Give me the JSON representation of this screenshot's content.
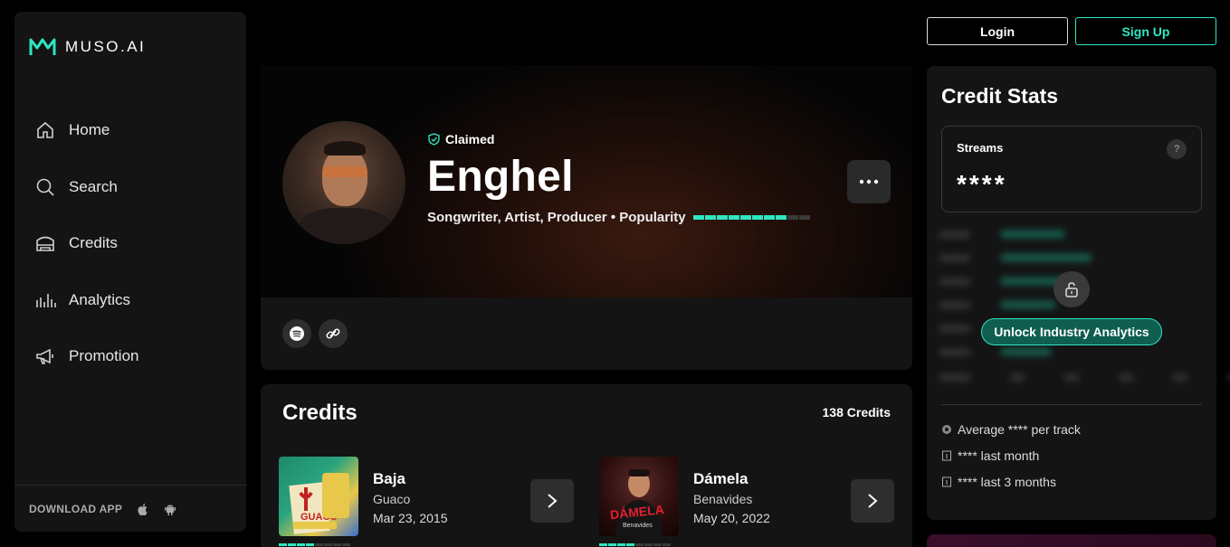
{
  "brand": {
    "name": "MUSO.AI",
    "accent": "#2ee6c2"
  },
  "sidebar": {
    "items": [
      {
        "label": "Home",
        "icon": "home-icon"
      },
      {
        "label": "Search",
        "icon": "search-icon"
      },
      {
        "label": "Credits",
        "icon": "credits-icon"
      },
      {
        "label": "Analytics",
        "icon": "analytics-icon"
      },
      {
        "label": "Promotion",
        "icon": "megaphone-icon"
      }
    ],
    "download_label": "DOWNLOAD APP"
  },
  "auth": {
    "login_label": "Login",
    "signup_label": "Sign Up"
  },
  "profile": {
    "claimed_label": "Claimed",
    "name": "Enghel",
    "roles": "Songwriter, Artist, Producer • Popularity",
    "popularity": 0.75
  },
  "credits": {
    "title": "Credits",
    "count": "138 Credits",
    "items": [
      {
        "title": "Baja",
        "artist": "Guaco",
        "date": "Mar 23, 2015",
        "cover_text": "GUACO",
        "popularity": 0.5
      },
      {
        "title": "Dámela",
        "artist": "Benavides",
        "date": "May 20, 2022",
        "cover_text": "DÁMELA",
        "popularity": 0.5
      }
    ]
  },
  "stats": {
    "title": "Credit Stats",
    "streams_label": "Streams",
    "help_label": "?",
    "streams_value": "****",
    "unlock_label": "Unlock Industry Analytics",
    "average_label": "Average **** per track",
    "last_month_label": "**** last month",
    "last_3_months_label": "**** last 3 months"
  }
}
